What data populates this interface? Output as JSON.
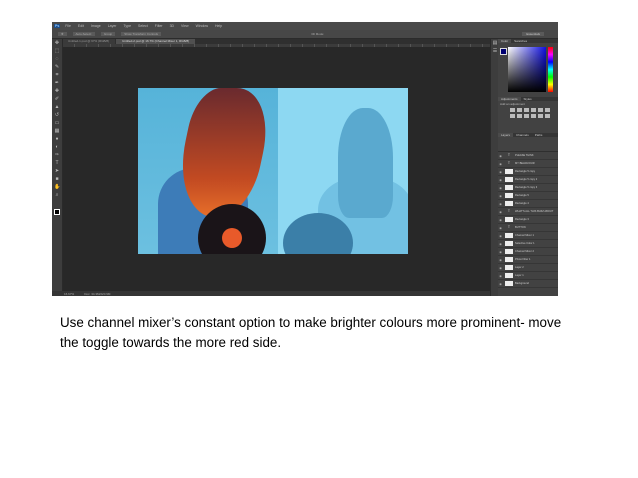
{
  "app": {
    "logo": "Ps",
    "menu": [
      "File",
      "Edit",
      "Image",
      "Layer",
      "Type",
      "Select",
      "Filter",
      "3D",
      "View",
      "Window",
      "Help"
    ],
    "options": [
      "Auto-Select:",
      "Group",
      "Show Transform Controls"
    ],
    "mode_label": "3D Mode:",
    "workspace": "Essentials",
    "tabs": [
      "Untitled-1.psd @ 67% (RGB/8)",
      "Untitled-2.psd @ 16.7% (Channel Mixer 1, RGB/8)"
    ],
    "status": {
      "zoom": "16.67%",
      "doc": "Doc: 34.3M/220.9M"
    }
  },
  "panels": {
    "color_tabs": [
      "Color",
      "Swatches"
    ],
    "adjust_tabs": [
      "Adjustments",
      "Styles"
    ],
    "adjust_title": "Add an adjustment",
    "layer_tabs": [
      "Layers",
      "Channels",
      "Paths"
    ],
    "layers": [
      {
        "name": "PLEASE THINK",
        "type": "text"
      },
      {
        "name": "MY BEHAVIOUR",
        "type": "text"
      },
      {
        "name": "Rectangle 5 copy",
        "type": "shape"
      },
      {
        "name": "Rectangle 5 copy 2",
        "type": "shape"
      },
      {
        "name": "Rectangle 5 copy 3",
        "type": "shape"
      },
      {
        "name": "Rectangle 5",
        "type": "shape"
      },
      {
        "name": "Rectangle 4",
        "type": "shape"
      },
      {
        "name": "WHAT'S ALL THIS BUZZ ABOUT",
        "type": "text"
      },
      {
        "name": "Rectangle 3",
        "type": "shape"
      },
      {
        "name": "BUTTON",
        "type": "text"
      },
      {
        "name": "Channel Mixer 1",
        "type": "adjust"
      },
      {
        "name": "Selective Color 1",
        "type": "adjust"
      },
      {
        "name": "Channel Mixer 2",
        "type": "adjust"
      },
      {
        "name": "Photo Filter 1",
        "type": "adjust"
      },
      {
        "name": "Layer 2",
        "type": "pixel"
      },
      {
        "name": "Layer 1",
        "type": "pixel"
      },
      {
        "name": "Background",
        "type": "pixel"
      }
    ]
  },
  "caption": "Use channel mixer’s constant option to make brighter colours more prominent- move the toggle towards the more red side."
}
